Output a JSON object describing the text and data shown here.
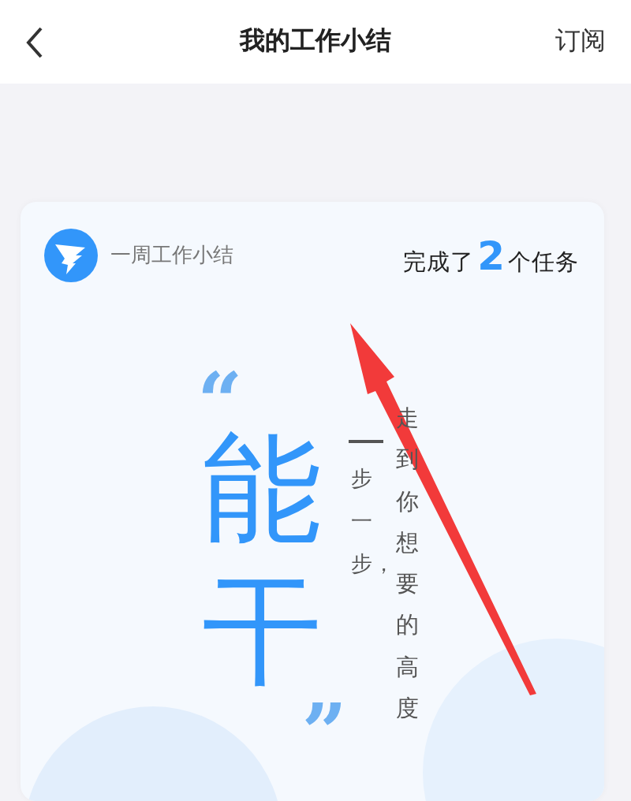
{
  "header": {
    "title": "我的工作小结",
    "action": "订阅"
  },
  "card": {
    "brand": "一周工作小结",
    "summary": {
      "prefix": "完成了",
      "count": "2",
      "suffix": "个任务"
    },
    "quote": {
      "open_mark": "“",
      "words": "能干",
      "close_mark": "”",
      "line_1": "步一步，",
      "line_2": "走到你想要的高度"
    }
  }
}
